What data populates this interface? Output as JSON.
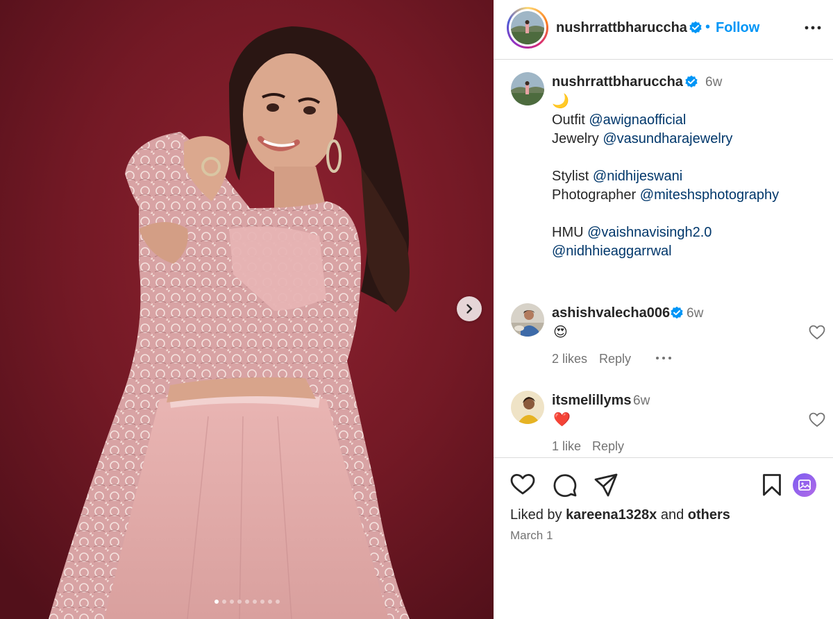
{
  "post": {
    "author": "nushrrattbharuccha",
    "follow_label": "Follow",
    "separator": "•"
  },
  "caption": {
    "username": "nushrrattbharuccha",
    "time": "6w",
    "emoji": "🌙",
    "lines": [
      {
        "label": "Outfit ",
        "mention": "@awignaofficial"
      },
      {
        "label": "Jewelry ",
        "mention": "@vasundharajewelry"
      },
      {
        "label": "",
        "mention": ""
      },
      {
        "label": "Stylist ",
        "mention": "@nidhijeswani"
      },
      {
        "label": "Photographer ",
        "mention": "@miteshsphotography"
      },
      {
        "label": "",
        "mention": ""
      },
      {
        "label": "HMU ",
        "mention": "@vaishnavisingh2.0"
      },
      {
        "label": "",
        "mention": "@nidhhieaggarrwal"
      }
    ]
  },
  "comments": [
    {
      "username": "ashishvalecha006",
      "verified": true,
      "time": "6w",
      "text": "😍",
      "likes": "2 likes",
      "reply": "Reply"
    },
    {
      "username": "itsmelillyms",
      "verified": false,
      "time": "6w",
      "text": "❤️",
      "likes": "1 like",
      "reply": "Reply"
    }
  ],
  "footer": {
    "liked_prefix": "Liked by ",
    "liked_user": "kareena1328x",
    "liked_middle": " and ",
    "liked_suffix": "others",
    "date": "March 1"
  },
  "carousel": {
    "count": 9,
    "active": 0
  },
  "colors": {
    "link": "#0095f6",
    "mention": "#00376b",
    "verified": "#0095f6",
    "muted": "#737373",
    "backdrop": "#7a1b27"
  }
}
